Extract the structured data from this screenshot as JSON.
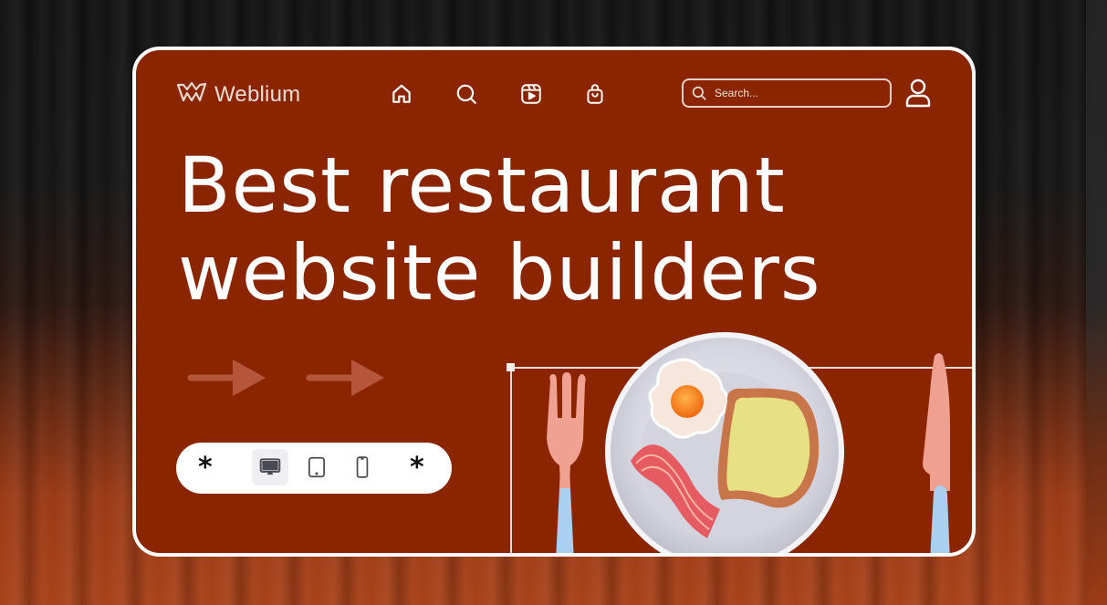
{
  "brand": {
    "name": "Weblium",
    "logo_icon": "crown-w-logo-icon"
  },
  "nav": {
    "items": [
      {
        "name": "home",
        "icon": "home-icon"
      },
      {
        "name": "search",
        "icon": "search-icon"
      },
      {
        "name": "video",
        "icon": "video-reel-icon"
      },
      {
        "name": "shop",
        "icon": "shopping-bag-icon"
      }
    ]
  },
  "search": {
    "placeholder": "Search...",
    "value": ""
  },
  "account": {
    "icon": "user-icon"
  },
  "hero": {
    "line1": "Best restaurant",
    "line2": "website builders"
  },
  "device_switcher": {
    "left_symbol": "*",
    "right_symbol": "*",
    "options": [
      {
        "name": "desktop",
        "icon": "desktop-icon",
        "active": true
      },
      {
        "name": "tablet",
        "icon": "tablet-icon",
        "active": false
      },
      {
        "name": "mobile",
        "icon": "mobile-icon",
        "active": false
      }
    ]
  },
  "illustration": {
    "items": [
      "fork",
      "plate",
      "fried-egg",
      "bacon",
      "toast",
      "knife"
    ]
  },
  "colors": {
    "card_background": "#8b2500",
    "card_border": "#ffffff",
    "text": "#ffffff",
    "arrow": "#b5553a",
    "device_bar": "#ffffff"
  }
}
